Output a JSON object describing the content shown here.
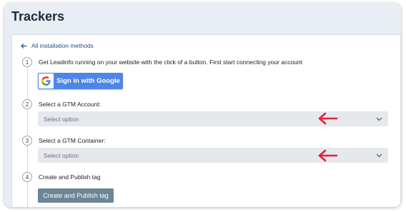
{
  "page": {
    "title": "Trackers"
  },
  "back_link": {
    "label": "All installation methods"
  },
  "steps": [
    {
      "number": "1",
      "text": "Get Leadinfo running on your website with the click of a button. First start connecting your account"
    },
    {
      "number": "2",
      "text": "Select a GTM Account:"
    },
    {
      "number": "3",
      "text": "Select a GTM Container:"
    },
    {
      "number": "4",
      "text": "Create and Publish tag"
    }
  ],
  "google_button": {
    "label": "Sign in with Google",
    "color": "#4e86e8",
    "icon": "google-g-icon"
  },
  "selects": {
    "account": {
      "value": "Select option",
      "icon": "chevron-down-icon"
    },
    "container": {
      "value": "Select option",
      "icon": "chevron-down-icon"
    }
  },
  "publish_button": {
    "label": "Create and Publish tag",
    "color": "#6b8595"
  },
  "annotation": {
    "arrow_color": "#e0243c",
    "icon": "arrow-left-icon"
  }
}
